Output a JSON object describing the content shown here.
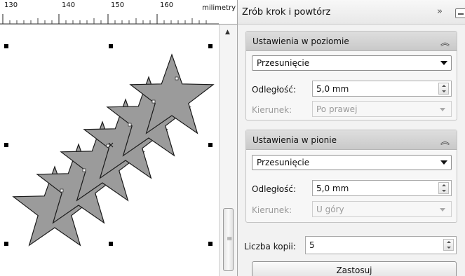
{
  "ruler": {
    "numbers": [
      "130",
      "140",
      "150",
      "160"
    ],
    "unit": "milimetry"
  },
  "docker": {
    "title": "Zrób krok i powtórz",
    "expand_icon": "double-chevron-right-icon",
    "minimize_icon": "minimize-icon"
  },
  "horizontal": {
    "title": "Ustawienia w poziomie",
    "mode": "Przesunięcie",
    "distance_label": "Odległość:",
    "distance_value": "5,0 mm",
    "direction_label": "Kierunek:",
    "direction_value": "Po prawej"
  },
  "vertical": {
    "title": "Ustawienia w pionie",
    "mode": "Przesunięcie",
    "distance_label": "Odległość:",
    "distance_value": "5,0 mm",
    "direction_label": "Kierunek:",
    "direction_value": "U góry"
  },
  "copies": {
    "label": "Liczba kopii:",
    "value": "5"
  },
  "apply_label": "Zastosuj",
  "colors": {
    "star_fill": "#9b9b9b",
    "star_stroke": "#1a1a1a",
    "handle": "#000000"
  }
}
